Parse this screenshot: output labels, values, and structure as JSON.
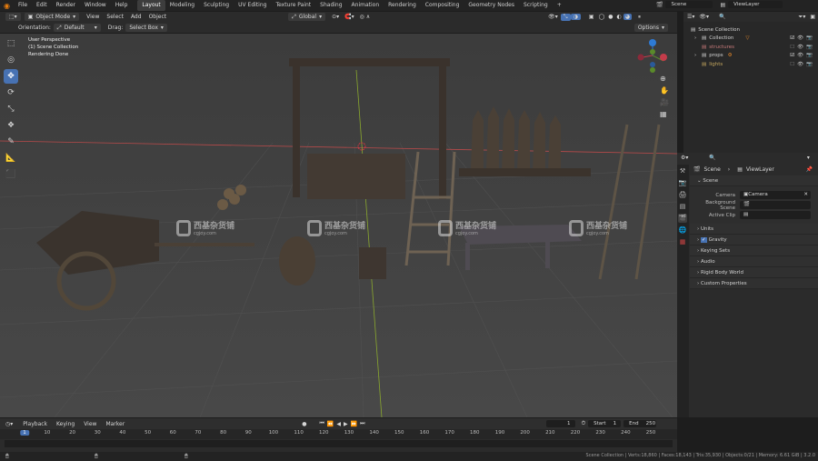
{
  "menus": [
    "File",
    "Edit",
    "Render",
    "Window",
    "Help"
  ],
  "workspaces": [
    "Layout",
    "Modeling",
    "Sculpting",
    "UV Editing",
    "Texture Paint",
    "Shading",
    "Animation",
    "Rendering",
    "Compositing",
    "Geometry Nodes",
    "Scripting",
    "+"
  ],
  "scene_name": "Scene",
  "view_layer_name": "ViewLayer",
  "header3d": {
    "mode": "Object Mode",
    "view": "View",
    "select": "Select",
    "add": "Add",
    "object": "Object",
    "transform": "Global"
  },
  "toolsettings": {
    "orientation_label": "Orientation:",
    "orientation": "Default",
    "drag_label": "Drag:",
    "drag": "Select Box",
    "options": "Options"
  },
  "viewport_text": {
    "line1": "User Perspective",
    "line2": "(1) Scene Collection",
    "line3": "Rendering Done"
  },
  "watermark": {
    "title": "西基杂货铺",
    "sub": "cgjoy.com"
  },
  "outliner": {
    "root": "Scene Collection",
    "items": [
      {
        "label": "Collection",
        "color": "#d0d0d0"
      },
      {
        "label": "structures",
        "color": "#c87a7a"
      },
      {
        "label": "props",
        "color": "#d0d0d0"
      },
      {
        "label": "lights",
        "color": "#c3a65e"
      }
    ]
  },
  "properties": {
    "breadcrumb_scene": "Scene",
    "breadcrumb_layer": "ViewLayer",
    "section": "Scene",
    "camera_label": "Camera",
    "camera_value": "Camera",
    "background_scene_label": "Background Scene",
    "active_clip_label": "Active Clip",
    "panels": [
      "Units",
      "Gravity",
      "Keying Sets",
      "Audio",
      "Rigid Body World",
      "Custom Properties"
    ],
    "gravity_checked": true
  },
  "timeline": {
    "menus": [
      "Playback",
      "Keying",
      "View",
      "Marker"
    ],
    "current_frame": "1",
    "start_label": "Start",
    "start": "1",
    "end_label": "End",
    "end": "250",
    "ticks": [
      "1",
      "10",
      "20",
      "30",
      "40",
      "50",
      "60",
      "70",
      "80",
      "90",
      "100",
      "110",
      "120",
      "130",
      "140",
      "150",
      "160",
      "170",
      "180",
      "190",
      "200",
      "210",
      "220",
      "230",
      "240",
      "250"
    ]
  },
  "status": "Scene Collection | Verts:18,860 | Faces:18,143 | Tris:35,930 | Objects:0/21 | Memory: 6.61 GiB | 3.2.0"
}
